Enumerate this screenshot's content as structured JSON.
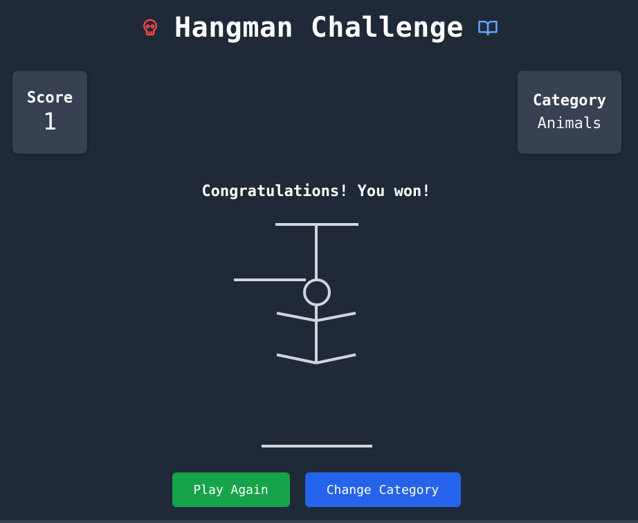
{
  "header": {
    "title": "Hangman Challenge",
    "left_icon": "skull-icon",
    "right_icon": "open-book-icon",
    "left_icon_color": "#ef4444",
    "right_icon_color": "#60a5fa"
  },
  "score": {
    "label": "Score",
    "value": "1"
  },
  "category": {
    "label": "Category",
    "value": "Animals"
  },
  "game": {
    "message": "Congratulations! You won!",
    "figure_color": "#d1d5db"
  },
  "buttons": {
    "play_again": "Play Again",
    "change_category": "Change Category",
    "play_again_color": "#16a34a",
    "change_category_color": "#2563eb"
  },
  "colors": {
    "background": "#1f2937",
    "card": "#374151"
  }
}
